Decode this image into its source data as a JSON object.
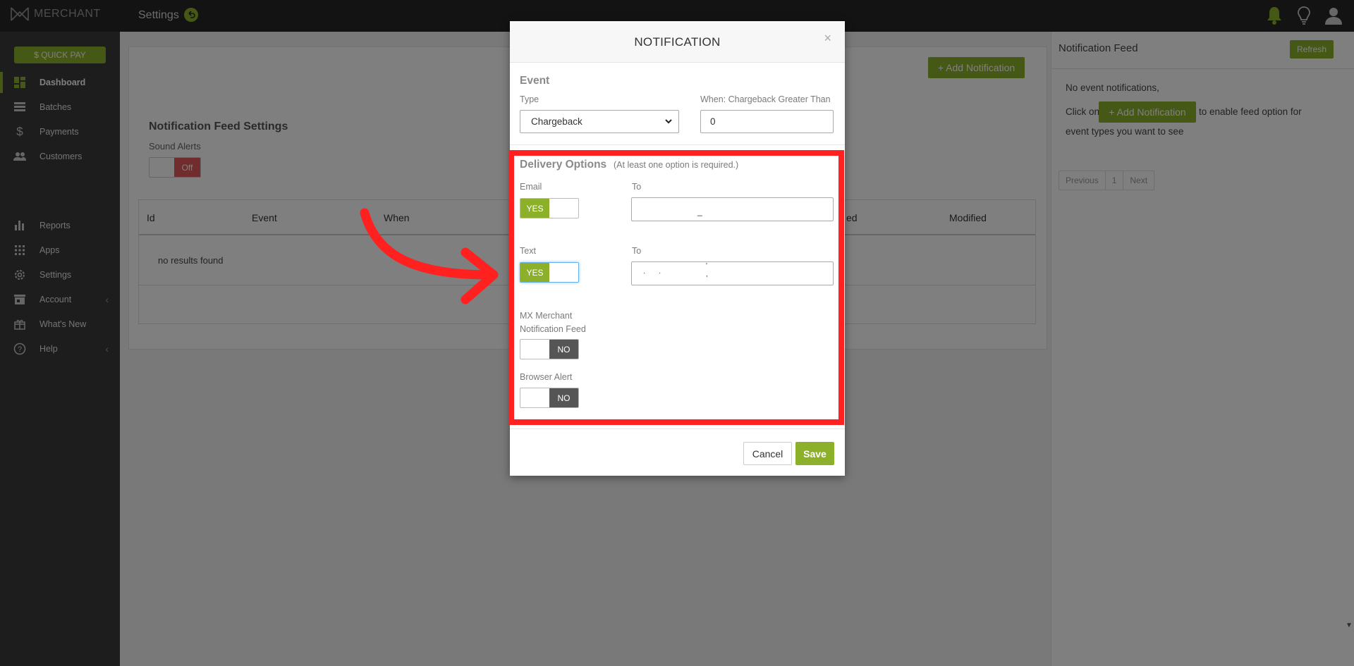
{
  "topbar": {
    "logo_text": "MERCHANT",
    "page_title": "Settings"
  },
  "sidebar": {
    "quick_pay": "$ QUICK PAY",
    "items": [
      {
        "label": "Dashboard",
        "icon": "dashboard-icon"
      },
      {
        "label": "Batches",
        "icon": "batches-icon"
      },
      {
        "label": "Payments",
        "icon": "dollar-icon"
      },
      {
        "label": "Customers",
        "icon": "customers-icon"
      },
      {
        "label": "Reports",
        "icon": "bar-chart-icon"
      },
      {
        "label": "Apps",
        "icon": "apps-grid-icon"
      },
      {
        "label": "Settings",
        "icon": "gear-icon"
      },
      {
        "label": "Account",
        "icon": "store-icon"
      },
      {
        "label": "What's New",
        "icon": "gift-icon"
      },
      {
        "label": "Help",
        "icon": "help-icon"
      }
    ]
  },
  "main": {
    "add_notification": "+ Add Notification",
    "feed_settings_title": "Notification Feed Settings",
    "sound_alerts_label": "Sound Alerts",
    "sound_toggle": "Off",
    "table": {
      "headers": [
        "Id",
        "Event",
        "When",
        "ed",
        "Modified"
      ],
      "empty": "no results found"
    }
  },
  "feed": {
    "title": "Notification Feed",
    "refresh": "Refresh",
    "no_events": "No event notifications,",
    "click_on": "Click on",
    "add_btn": "+ Add Notification",
    "enable_text": "to enable feed option for",
    "event_types_text": "event types you want to see",
    "pager": [
      "Previous",
      "1",
      "Next"
    ]
  },
  "modal": {
    "title": "NOTIFICATION",
    "close": "×",
    "event_title": "Event",
    "type_label": "Type",
    "type_value": "Chargeback",
    "when_label": "When: Chargeback Greater Than",
    "when_value": "0",
    "delivery_title": "Delivery Options",
    "delivery_note": "(At least one option is required.)",
    "email_label": "Email",
    "email_toggle": "YES",
    "email_to_label": "To",
    "text_label": "Text",
    "text_toggle": "YES",
    "text_to_label": "To",
    "feed_label_1": "MX Merchant",
    "feed_label_2": "Notification Feed",
    "feed_toggle": "NO",
    "browser_label": "Browser Alert",
    "browser_toggle": "NO",
    "cancel": "Cancel",
    "save": "Save"
  },
  "colors": {
    "accent": "#8cb02a",
    "highlight": "#ff2020",
    "topbar": "#262626",
    "sidebar": "#3b3b3b"
  }
}
